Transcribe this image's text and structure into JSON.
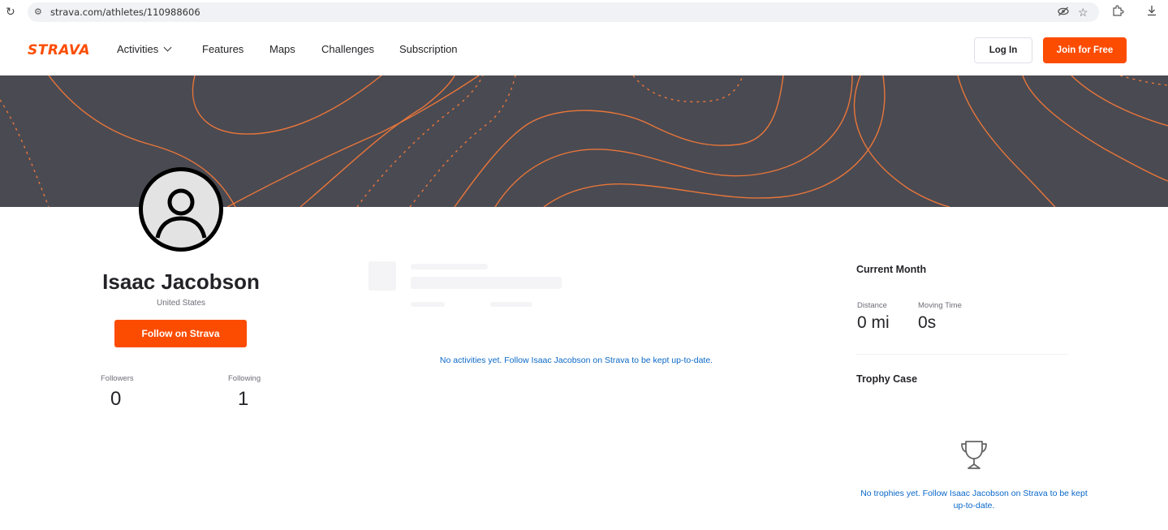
{
  "browser": {
    "url": "strava.com/athletes/110988606",
    "reload_icon": "reload-icon",
    "site_info_icon": "site-info-icon",
    "eye_off_icon": "eye-off-icon",
    "star_icon": "star-icon",
    "extensions_icon": "extensions-icon",
    "download_icon": "download-icon"
  },
  "nav": {
    "logo": "STRAVA",
    "links": [
      "Activities",
      "Features",
      "Maps",
      "Challenges",
      "Subscription"
    ],
    "login_label": "Log In",
    "join_label": "Join for Free"
  },
  "profile": {
    "name": "Isaac Jacobson",
    "country": "United States",
    "follow_label": "Follow on Strava",
    "followers_label": "Followers",
    "followers_value": "0",
    "following_label": "Following",
    "following_value": "1"
  },
  "feed": {
    "empty_message": "No activities yet. Follow Isaac Jacobson on Strava to be kept up-to-date."
  },
  "sidebar": {
    "current_month_title": "Current Month",
    "distance_label": "Distance",
    "distance_value": "0 mi",
    "moving_time_label": "Moving Time",
    "moving_time_value": "0s",
    "trophy_case_title": "Trophy Case",
    "no_trophies_message": "No trophies yet. Follow Isaac Jacobson on Strava to be kept up-to-date."
  },
  "colors": {
    "brand": "#fc4c02",
    "banner": "#4a4a52",
    "link": "#0a68c8"
  }
}
